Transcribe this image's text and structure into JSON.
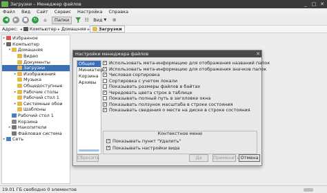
{
  "window": {
    "title": "Загрузки – Менеджер файлов"
  },
  "menu": [
    "Файл",
    "Вид",
    "Сайт",
    "Сервис",
    "Настройка",
    "Справка"
  ],
  "toolbar": {
    "folders_label": "Папки",
    "view_label": "Вид"
  },
  "address": {
    "label": "Адрес:",
    "crumbs": [
      "Компьютер",
      "Домашняя",
      "Загрузки"
    ]
  },
  "tree": [
    {
      "label": "Избранное",
      "expanded": false
    },
    {
      "label": "Компьютер",
      "expanded": true
    },
    {
      "label": "Домашняя",
      "expanded": true
    },
    {
      "label": "Видео",
      "expanded": false
    },
    {
      "label": "Документы",
      "expanded": false
    },
    {
      "label": "Загрузки",
      "expanded": false,
      "selected": true
    },
    {
      "label": "Изображения",
      "expanded": false
    },
    {
      "label": "Музыка",
      "expanded": false
    },
    {
      "label": "Общедоступные",
      "expanded": false
    },
    {
      "label": "Рабочие столы",
      "expanded": false
    },
    {
      "label": "Рабочий стол 1",
      "expanded": false
    },
    {
      "label": "Системные обои",
      "expanded": false
    },
    {
      "label": "Шаблоны",
      "expanded": false
    },
    {
      "label": "Рабочий стол 1",
      "expanded": false
    },
    {
      "label": "Корзина",
      "expanded": false
    },
    {
      "label": "Накопители",
      "expanded": false
    },
    {
      "label": "Файловая система",
      "expanded": false
    },
    {
      "label": "Сеть",
      "expanded": false
    }
  ],
  "dialog": {
    "title": "Настройки менеджера файлов",
    "sections": [
      "Общее",
      "Миниатюры",
      "Корзина",
      "Архивы"
    ],
    "options": [
      {
        "label": "Использовать мета-информацию для отображения названий папок",
        "checked": true
      },
      {
        "label": "Использовать мета-информацию для отображения значков папок",
        "checked": true
      },
      {
        "label": "Числовая сортировка",
        "checked": true
      },
      {
        "label": "Сортировка с учетом локали",
        "checked": false
      },
      {
        "label": "Показывать размеры файлов в байтах",
        "checked": false
      },
      {
        "label": "Чередовать цвета строк в таблице",
        "checked": true
      },
      {
        "label": "Показывать полный путь в заголовке окна",
        "checked": false
      },
      {
        "label": "Показывать ползунок масштаба в строке состояния",
        "checked": true
      },
      {
        "label": "Показывать сведения о месте на диске в строке состояния",
        "checked": true
      }
    ],
    "context_menu": {
      "title": "Контекстное меню",
      "options": [
        {
          "label": "Показывать пункт \"Удалить\"",
          "checked": true
        },
        {
          "label": "Показывать настройки вида",
          "checked": true
        }
      ]
    },
    "buttons": {
      "reset": "Сбросить",
      "ok": "Да",
      "apply": "Применить",
      "cancel": "Отмена"
    }
  },
  "status": {
    "text": "19.01 ГБ свободно    0 элементов"
  }
}
